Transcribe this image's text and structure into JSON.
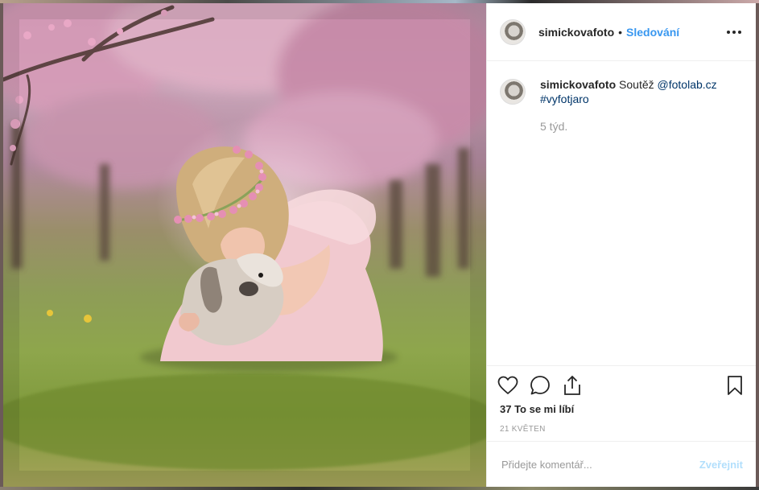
{
  "post": {
    "photo_alt": "photo-girl-with-rabbit",
    "author": {
      "username": "simickovafoto",
      "avatar_icon": "avatar-photo"
    },
    "separator": "•",
    "follow_label": "Sledování",
    "more_icon": "more-options-icon",
    "caption": {
      "username": "simickovafoto",
      "text": "Soutěž",
      "mention": "@fotolab.cz",
      "hashtag": "#vyfotjaro"
    },
    "time_ago": "5 týd.",
    "likes_label": "37 To se mi líbí",
    "date": "21 KVĚTEN",
    "comment_placeholder": "Přidejte komentář...",
    "post_label": "Zveřejnit"
  },
  "colors": {
    "accent": "#3897f0",
    "link": "#003569",
    "muted": "#999999",
    "post_disabled": "#b2dffc"
  }
}
